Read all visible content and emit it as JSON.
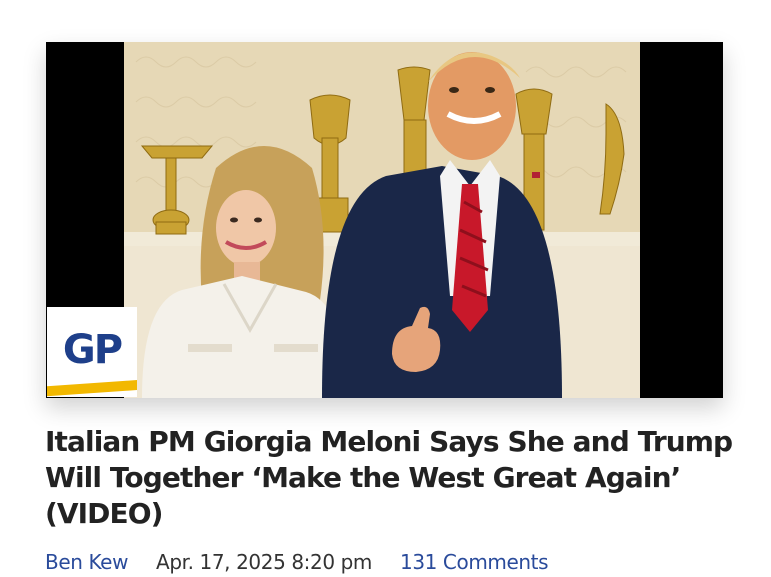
{
  "article": {
    "headline": "Italian PM Giorgia Meloni Says She and Trump Will Together ‘Make the West Great Again’ (VIDEO)",
    "author": "Ben Kew",
    "date": "Apr. 17, 2025 8:20 pm",
    "comments": "131 Comments"
  },
  "logo": {
    "text": "GP",
    "text_color": "#1e3f8a",
    "stripe_color": "#f2b800"
  },
  "colors": {
    "link": "#2a4b9b",
    "headline": "#222222",
    "meta_text": "#333333"
  }
}
